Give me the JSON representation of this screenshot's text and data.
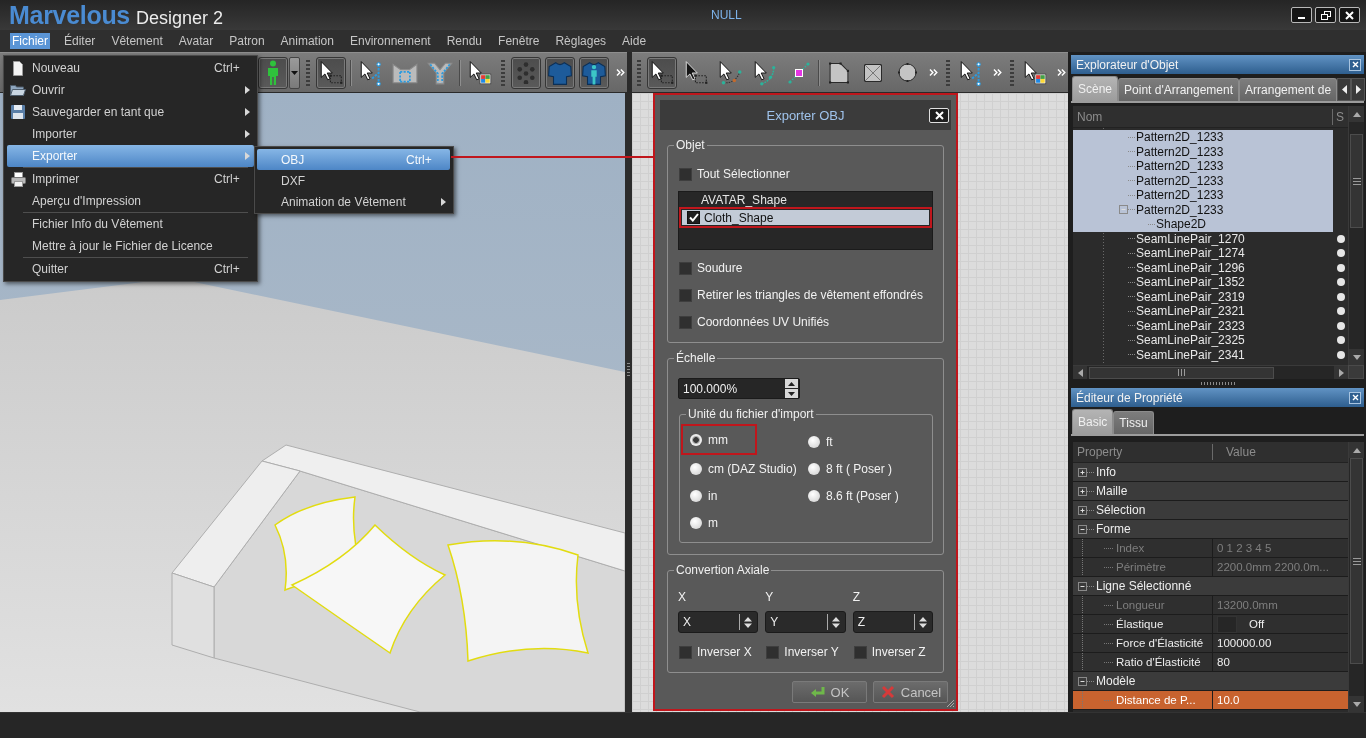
{
  "window": {
    "logo": "Marvelous",
    "logo_suffix": "Designer 2",
    "title": "NULL"
  },
  "menubar": [
    {
      "label": "Fichier",
      "selected": true
    },
    {
      "label": "Éditer",
      "selected": false
    },
    {
      "label": "Vêtement",
      "selected": false
    },
    {
      "label": "Avatar",
      "selected": false
    },
    {
      "label": "Patron",
      "selected": false
    },
    {
      "label": "Animation",
      "selected": false
    },
    {
      "label": "Environnement",
      "selected": false
    },
    {
      "label": "Rendu",
      "selected": false
    },
    {
      "label": "Fenêtre",
      "selected": false
    },
    {
      "label": "Règlages",
      "selected": false
    },
    {
      "label": "Aide",
      "selected": false
    }
  ],
  "file_menu": {
    "groups": [
      [
        {
          "kind": "new",
          "label": "Nouveau",
          "shortcut": "Ctrl+",
          "submenu": false,
          "selected": false
        },
        {
          "kind": "open",
          "label": "Ouvrir",
          "submenu": true,
          "selected": false
        },
        {
          "kind": "save",
          "label": "Sauvegarder en tant que",
          "submenu": true,
          "selected": false
        },
        {
          "kind": "plain",
          "label": "Importer",
          "submenu": true,
          "selected": false
        },
        {
          "kind": "plain",
          "label": "Exporter",
          "submenu": true,
          "selected": true
        }
      ],
      [
        {
          "kind": "print",
          "label": "Imprimer",
          "shortcut": "Ctrl+",
          "submenu": false,
          "selected": false
        },
        {
          "kind": "plain",
          "label": "Aperçu d'Impression",
          "submenu": false,
          "selected": false
        }
      ],
      [
        {
          "kind": "plain",
          "label": "Fichier Info du Vêtement",
          "submenu": false,
          "selected": false
        },
        {
          "kind": "plain",
          "label": "Mettre à jour le Fichier de Licence",
          "submenu": false,
          "selected": false
        }
      ],
      [
        {
          "kind": "plain",
          "label": "Quitter",
          "shortcut": "Ctrl+",
          "submenu": false,
          "selected": false
        }
      ]
    ]
  },
  "export_submenu": {
    "items": [
      {
        "label": "OBJ",
        "shortcut": "Ctrl+",
        "submenu": false,
        "selected": true
      },
      {
        "label": "DXF",
        "submenu": false,
        "selected": false
      },
      {
        "label": "Animation de Vêtement",
        "submenu": true,
        "selected": false
      }
    ]
  },
  "toolbars": [
    {
      "sections": [
        {
          "grip": false,
          "overflow": false,
          "groups": [
            [
              {
                "kind": "avatar",
                "selected": true,
                "dropdown": true
              }
            ]
          ]
        },
        {
          "grip": true,
          "overflow": false,
          "groups": [
            [
              {
                "kind": "select",
                "selected": true
              }
            ],
            [
              {
                "kind": "select_seam",
                "selected": false
              },
              {
                "kind": "pattern_segment",
                "selected": false
              },
              {
                "kind": "pattern_y",
                "selected": false
              }
            ],
            [
              {
                "kind": "select_texture",
                "selected": false
              }
            ]
          ]
        },
        {
          "grip": true,
          "overflow": true,
          "groups": [
            [
              {
                "kind": "dots",
                "selected": true
              },
              {
                "kind": "shirt",
                "selected": true
              },
              {
                "kind": "shirt_avatar",
                "selected": true
              }
            ]
          ]
        }
      ]
    },
    {
      "sections": [
        {
          "grip": true,
          "overflow": true,
          "groups": [
            [
              {
                "kind": "select",
                "selected": true
              },
              {
                "kind": "select_point",
                "selected": false
              },
              {
                "kind": "edit_curve",
                "selected": false
              },
              {
                "kind": "edit_curve_point",
                "selected": false
              },
              {
                "kind": "add_point",
                "selected": false
              }
            ],
            [
              {
                "kind": "polygon",
                "selected": false
              },
              {
                "kind": "rectangle",
                "selected": false
              },
              {
                "kind": "circle",
                "selected": false
              }
            ]
          ]
        },
        {
          "grip": true,
          "overflow": true,
          "groups": [
            [
              {
                "kind": "select_seam",
                "selected": false
              }
            ]
          ]
        },
        {
          "grip": true,
          "overflow": true,
          "groups": [
            [
              {
                "kind": "select_texture",
                "selected": false
              }
            ]
          ]
        }
      ]
    }
  ],
  "export_dialog": {
    "title": "Exporter OBJ",
    "highlighted": true,
    "object_group": {
      "title": "Objet",
      "select_all": {
        "label": "Tout Sélectionner",
        "checked": false
      },
      "objects": [
        {
          "label": "AVATAR_Shape",
          "selected": false
        },
        {
          "label": "Cloth_Shape",
          "selected": true,
          "checked": true,
          "highlighted": true
        }
      ],
      "options": [
        {
          "label": "Soudure",
          "checked": false
        },
        {
          "label": "Retirer les triangles de vêtement effondrés",
          "checked": false
        },
        {
          "label": "Coordonnées UV Unifiés",
          "checked": false
        }
      ]
    },
    "scale_group": {
      "title": "Échelle",
      "value": "100.000%",
      "unit_group": {
        "title": "Unité du fichier d'import",
        "units": [
          {
            "label": "mm",
            "selected": true,
            "highlighted": true
          },
          {
            "label": "ft",
            "selected": false
          },
          {
            "label": "cm (DAZ Studio)",
            "selected": false
          },
          {
            "label": "8 ft ( Poser )",
            "selected": false
          },
          {
            "label": "in",
            "selected": false
          },
          {
            "label": "8.6 ft (Poser )",
            "selected": false
          },
          {
            "label": "m",
            "selected": false
          }
        ]
      }
    },
    "axis_group": {
      "title": "Convertion Axiale",
      "axes": [
        {
          "label": "X",
          "value": "X",
          "invert": {
            "label": "Inverser X",
            "checked": false
          }
        },
        {
          "label": "Y",
          "value": "Y",
          "invert": {
            "label": "Inverser Y",
            "checked": false
          }
        },
        {
          "label": "Z",
          "value": "Z",
          "invert": {
            "label": "Inverser Z",
            "checked": false
          }
        }
      ]
    },
    "buttons": [
      {
        "kind": "ok",
        "label": "OK"
      },
      {
        "kind": "cancel",
        "label": "Cancel"
      }
    ]
  },
  "object_explorer": {
    "title": "Explorateur d'Objet",
    "tabs": [
      {
        "label": "Scène",
        "selected": true
      },
      {
        "label": "Point d'Arrangement",
        "selected": false
      },
      {
        "label": "Arrangement de",
        "selected": false
      }
    ],
    "columns": [
      "Nom",
      "S"
    ],
    "nodes": [
      {
        "label": "Pattern2D_1233",
        "selected": true,
        "shown": false
      },
      {
        "label": "Pattern2D_1233",
        "selected": true,
        "shown": false
      },
      {
        "label": "Pattern2D_1233",
        "selected": true,
        "shown": false
      },
      {
        "label": "Pattern2D_1233",
        "selected": true,
        "shown": false
      },
      {
        "label": "Pattern2D_1233",
        "selected": true,
        "shown": false
      },
      {
        "label": "Pattern2D_1233",
        "selected": true,
        "shown": false,
        "expanded": true,
        "children": [
          {
            "label": "Shape2D",
            "selected": true,
            "shown": false
          }
        ]
      },
      {
        "label": "SeamLinePair_1270",
        "selected": false,
        "shown": true
      },
      {
        "label": "SeamLinePair_1274",
        "selected": false,
        "shown": true
      },
      {
        "label": "SeamLinePair_1296",
        "selected": false,
        "shown": true
      },
      {
        "label": "SeamLinePair_1352",
        "selected": false,
        "shown": true
      },
      {
        "label": "SeamLinePair_2319",
        "selected": false,
        "shown": true
      },
      {
        "label": "SeamLinePair_2321",
        "selected": false,
        "shown": true
      },
      {
        "label": "SeamLinePair_2323",
        "selected": false,
        "shown": true
      },
      {
        "label": "SeamLinePair_2325",
        "selected": false,
        "shown": true
      },
      {
        "label": "SeamLinePair_2341",
        "selected": false,
        "shown": true
      }
    ]
  },
  "property_editor": {
    "title": "Éditeur de Propriété",
    "tabs": [
      {
        "label": "Basic",
        "selected": true
      },
      {
        "label": "Tissu",
        "selected": false
      }
    ],
    "columns": [
      "Property",
      "Value"
    ],
    "rows": [
      {
        "label": "Info",
        "expanded": false
      },
      {
        "label": "Maille",
        "expanded": false
      },
      {
        "label": "Sélection",
        "expanded": false
      },
      {
        "label": "Forme",
        "expanded": true,
        "children": [
          {
            "kind": "text",
            "label": "Index",
            "value": "0 1 2 3 4 5",
            "disabled": true,
            "selected": false
          },
          {
            "kind": "text",
            "label": "Périmètre",
            "value": "2200.0mm 2200.0m...",
            "disabled": true,
            "selected": false
          }
        ]
      },
      {
        "label": "Ligne Sélectionné",
        "expanded": true,
        "children": [
          {
            "kind": "text",
            "label": "Longueur",
            "value": "13200.0mm",
            "disabled": true,
            "selected": false
          },
          {
            "kind": "toggle",
            "label": "Élastique",
            "checked": false,
            "value": "Off",
            "disabled": false,
            "selected": false
          },
          {
            "kind": "text",
            "label": "Force d'Élasticité",
            "value": "100000.00",
            "disabled": false,
            "selected": false
          },
          {
            "kind": "text",
            "label": "Ratio d'Élasticité",
            "value": "80",
            "disabled": false,
            "selected": false
          }
        ]
      },
      {
        "label": "Modèle",
        "expanded": true,
        "children": [
          {
            "kind": "text",
            "label": "Distance de P...",
            "value": "10.0",
            "disabled": false,
            "selected": true
          }
        ]
      }
    ]
  }
}
